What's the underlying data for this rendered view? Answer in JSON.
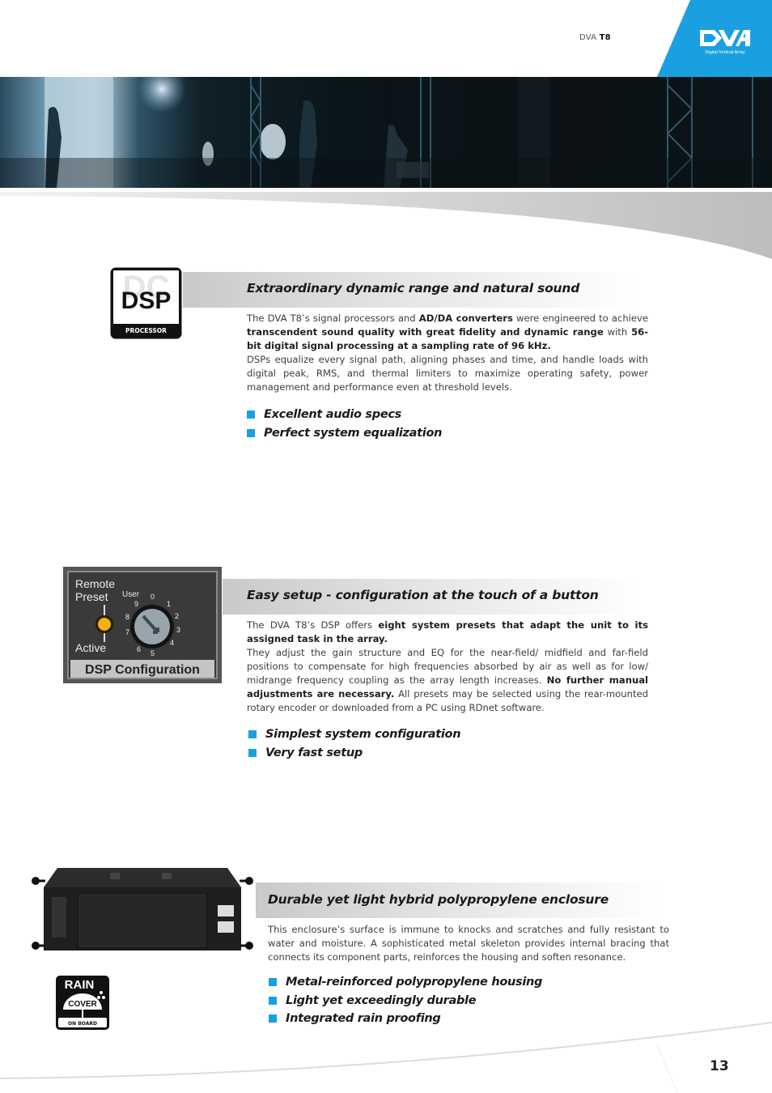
{
  "header": {
    "product_prefix": "DVA",
    "product_model": "T8",
    "brand_logo_text": "DVA",
    "brand_tagline": "Digital Vertical Array",
    "brand_color": "#1aa0e0"
  },
  "hero": {
    "image_alt": "Concert stage with musicians and lighting trusses"
  },
  "sections": [
    {
      "icon": {
        "name": "dsp-processor-icon",
        "title": "DSP",
        "subtitle": "PROCESSOR"
      },
      "heading": "Extraordinary dynamic range and natural sound",
      "paragraph": [
        {
          "text": "The DVA T8’s signal processors and ",
          "bold": false
        },
        {
          "text": "AD/DA converters",
          "bold": true
        },
        {
          "text": " were engineered to achieve ",
          "bold": false
        },
        {
          "text": "transcendent sound quality with great fidelity and dynamic range",
          "bold": true
        },
        {
          "text": " with ",
          "bold": false
        },
        {
          "text": "56-bit digital signal processing at a sampling rate of 96 kHz.",
          "bold": true
        },
        {
          "text": "\n",
          "bold": false
        },
        {
          "text": "DSPs equalize every signal path, aligning phases and time, and handle loads with digital peak, RMS, and thermal limiters to maximize operating safety, power management and performance even at threshold levels.",
          "bold": false
        }
      ],
      "bullets": [
        "Excellent audio specs",
        "Perfect system equalization"
      ]
    },
    {
      "icon": {
        "name": "dsp-configuration-panel",
        "label_remote": "Remote",
        "label_preset": "Preset",
        "label_active": "Active",
        "label_user": "User",
        "dial_numbers": [
          "0",
          "1",
          "2",
          "3",
          "4",
          "5",
          "6",
          "7",
          "8",
          "9"
        ],
        "caption": "DSP Configuration"
      },
      "heading": "Easy setup - configuration at the touch of a button",
      "paragraph": [
        {
          "text": "The DVA T8’s DSP offers ",
          "bold": false
        },
        {
          "text": "eight system presets that adapt the unit to its assigned task in the array.",
          "bold": true
        },
        {
          "text": "\n",
          "bold": false
        },
        {
          "text": "They adjust the gain structure and EQ for the near-field/ midfield and far-field positions to compensate for high frequencies absorbed by air as well as for low/ midrange frequency coupling as the array length increases. ",
          "bold": false
        },
        {
          "text": "No further manual adjustments are necessary.",
          "bold": true
        },
        {
          "text": " All presets may be selected using the rear-mounted rotary encoder or downloaded from a PC using RDnet software.",
          "bold": false
        }
      ],
      "bullets": [
        "Simplest system configuration",
        "Very fast setup"
      ]
    },
    {
      "icon": {
        "name": "rain-cover-icon",
        "title": "RAIN",
        "middle": "COVER",
        "subtitle": "ON BOARD"
      },
      "heading": "Durable yet light hybrid polypropylene enclosure",
      "paragraph": [
        {
          "text": "This enclosure’s surface is immune to knocks and scratches and fully resistant to water and moisture. A sophisticated metal skeleton provides internal bracing that connects its component parts, reinforces the housing and soften resonance.",
          "bold": false
        }
      ],
      "bullets": [
        "Metal-reinforced polypropylene housing",
        "Light yet exceedingly durable",
        "Integrated rain proofing"
      ]
    }
  ],
  "footer": {
    "page_number": "13"
  }
}
